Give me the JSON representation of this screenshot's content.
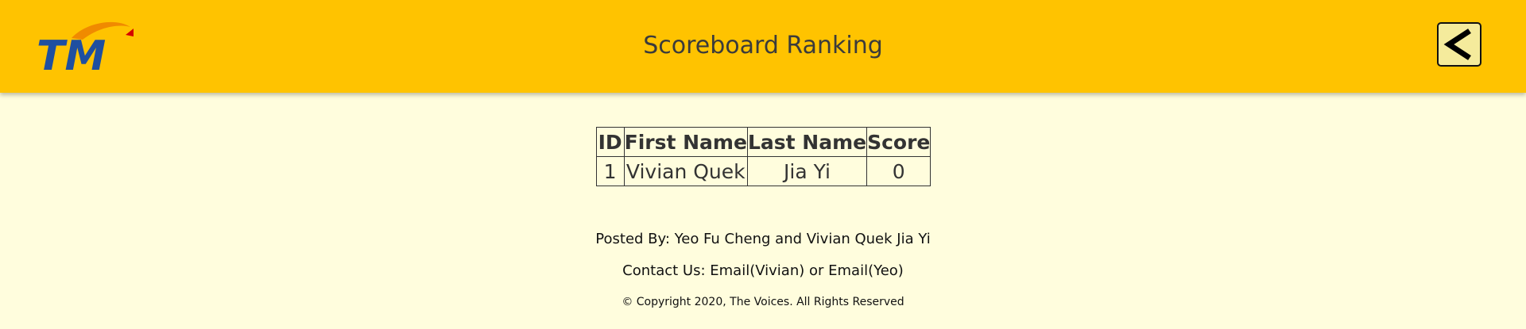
{
  "header": {
    "logo_text": "TM",
    "title": "Scoreboard Ranking",
    "back_icon": "chevron-left-icon"
  },
  "table": {
    "columns": [
      "ID",
      "First Name",
      "Last Name",
      "Score"
    ],
    "rows": [
      {
        "id": "1",
        "first_name": "Vivian Quek",
        "last_name": "Jia Yi",
        "score": "0"
      }
    ]
  },
  "footer": {
    "posted_by": "Posted By: Yeo Fu Cheng and Vivian Quek Jia Yi",
    "contact_prefix": "Contact Us: ",
    "email_vivian": "Email(Vivian)",
    "contact_or": " or ",
    "email_yeo": "Email(Yeo)",
    "copyright": "© Copyright 2020, The Voices. All Rights Reserved"
  },
  "colors": {
    "header_bg": "#ffc300",
    "page_bg": "#fffddd",
    "logo_blue": "#1f4fa0",
    "logo_orange": "#f08a00",
    "back_button_bg": "#f5eb9c"
  }
}
